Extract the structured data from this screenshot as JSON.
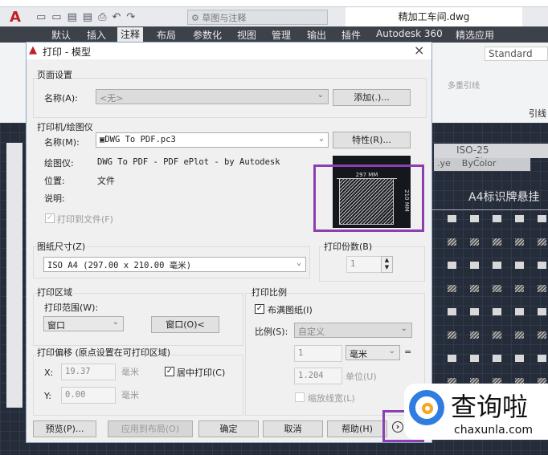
{
  "app": {
    "quick_access_workspace": "草图与注释",
    "file_title": "精加工车间.dwg",
    "ribbon_tabs": [
      "默认",
      "插入",
      "注释",
      "布局",
      "参数化",
      "视图",
      "管理",
      "输出",
      "插件",
      "Autodesk 360",
      "精选应用"
    ],
    "ribbon_active": "注释",
    "style_name": "Standard",
    "multileader_label": "多重引线",
    "leader_panel": "引线",
    "dim_style": "ISO-25",
    "text_style": "Stan",
    "linetype": ".ye",
    "color": "ByColor",
    "drawing_title": "A4标识牌悬挂"
  },
  "dialog": {
    "title": "打印 - 模型",
    "close": "×",
    "page_setup": {
      "heading": "页面设置",
      "name_label": "名称(A):",
      "name_value": "<无>",
      "add_button": "添加(.)..."
    },
    "printer": {
      "heading": "打印机/绘图仪",
      "name_label": "名称(M):",
      "name_value": "DWG To PDF.pc3",
      "properties_button": "特性(R)...",
      "plotter_label": "绘图仪:",
      "plotter_value": "DWG To PDF - PDF ePlot - by Autodesk",
      "location_label": "位置:",
      "location_value": "文件",
      "description_label": "说明:",
      "print_to_file": "打印到文件(F)",
      "preview_width": "297 MM",
      "preview_height": "210 MM"
    },
    "paper_size": {
      "heading": "图纸尺寸(Z)",
      "value": "ISO A4 (297.00 x 210.00 毫米)"
    },
    "copies": {
      "heading": "打印份数(B)",
      "value": "1"
    },
    "plot_area": {
      "heading": "打印区域",
      "range_label": "打印范围(W):",
      "range_value": "窗口",
      "window_button": "窗口(O)<"
    },
    "offset": {
      "heading": "打印偏移 (原点设置在可打印区域)",
      "x_label": "X:",
      "x_value": "19.37",
      "y_label": "Y:",
      "y_value": "0.00",
      "unit": "毫米",
      "center_label": "居中打印(C)",
      "center_checked": true
    },
    "scale": {
      "heading": "打印比例",
      "fit_label": "布满图纸(I)",
      "fit_checked": true,
      "scale_label": "比例(S):",
      "scale_value": "自定义",
      "value1": "1",
      "unit1": "毫米",
      "equals": "=",
      "value2": "1.204",
      "unit2": "单位(U)",
      "lineweights": "缩放线宽(L)"
    },
    "buttons": {
      "preview": "预览(P)...",
      "apply": "应用到布局(O)",
      "ok": "确定",
      "cancel": "取消",
      "help": "帮助(H)",
      "more": "›"
    }
  },
  "watermark": {
    "name": "查询啦",
    "url": "chaxunla.com"
  }
}
